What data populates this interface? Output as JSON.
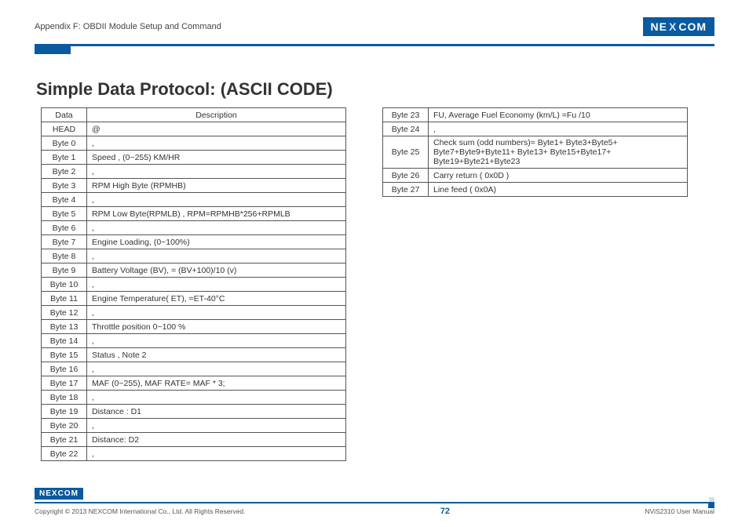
{
  "header": {
    "appendix": "Appendix F: OBDII Module Setup and Command",
    "logo_text_a": "NE",
    "logo_text_x": "X",
    "logo_text_b": "COM"
  },
  "title": "Simple Data Protocol: (ASCII CODE)",
  "table_left": {
    "head_data": "Data",
    "head_desc": "Description",
    "rows": [
      {
        "data": "HEAD",
        "desc": "@"
      },
      {
        "data": "Byte 0",
        "desc": ","
      },
      {
        "data": "Byte 1",
        "desc": "Speed , (0~255) KM/HR"
      },
      {
        "data": "Byte 2",
        "desc": ","
      },
      {
        "data": "Byte 3",
        "desc": "RPM High Byte (RPMHB)"
      },
      {
        "data": "Byte 4",
        "desc": ","
      },
      {
        "data": "Byte 5",
        "desc": "RPM Low Byte(RPMLB) , RPM=RPMHB*256+RPMLB"
      },
      {
        "data": "Byte 6",
        "desc": ","
      },
      {
        "data": "Byte 7",
        "desc": "Engine Loading, (0~100%)"
      },
      {
        "data": "Byte 8",
        "desc": ","
      },
      {
        "data": "Byte 9",
        "desc": "Battery Voltage (BV), = (BV+100)/10 (v)"
      },
      {
        "data": "Byte 10",
        "desc": ","
      },
      {
        "data": "Byte 11",
        "desc": "Engine Temperature( ET), =ET-40°C"
      },
      {
        "data": "Byte 12",
        "desc": ","
      },
      {
        "data": "Byte 13",
        "desc": "Throttle position 0~100 %"
      },
      {
        "data": "Byte 14",
        "desc": ","
      },
      {
        "data": "Byte 15",
        "desc": "Status , Note 2"
      },
      {
        "data": "Byte 16",
        "desc": ","
      },
      {
        "data": "Byte 17",
        "desc": "MAF (0~255), MAF RATE= MAF * 3;"
      },
      {
        "data": "Byte 18",
        "desc": ","
      },
      {
        "data": "Byte 19",
        "desc": "Distance : D1"
      },
      {
        "data": "Byte 20",
        "desc": ","
      },
      {
        "data": "Byte 21",
        "desc": "Distance: D2"
      },
      {
        "data": "Byte 22",
        "desc": ","
      }
    ]
  },
  "table_right": {
    "rows": [
      {
        "data": "Byte 23",
        "desc": "FU, Average Fuel Economy (km/L) =Fu /10"
      },
      {
        "data": "Byte 24",
        "desc": ","
      },
      {
        "data": "Byte 25",
        "desc": "Check sum (odd numbers)= Byte1+ Byte3+Byte5+ Byte7+Byte9+Byte11+ Byte13+ Byte15+Byte17+ Byte19+Byte21+Byte23"
      },
      {
        "data": "Byte 26",
        "desc": "Carry return ( 0x0D )"
      },
      {
        "data": "Byte 27",
        "desc": "Line feed ( 0x0A)"
      }
    ]
  },
  "footer": {
    "copyright": "Copyright © 2013 NEXCOM International Co., Ltd. All Rights Reserved.",
    "page": "72",
    "manual": "NViS2310 User Manual"
  }
}
